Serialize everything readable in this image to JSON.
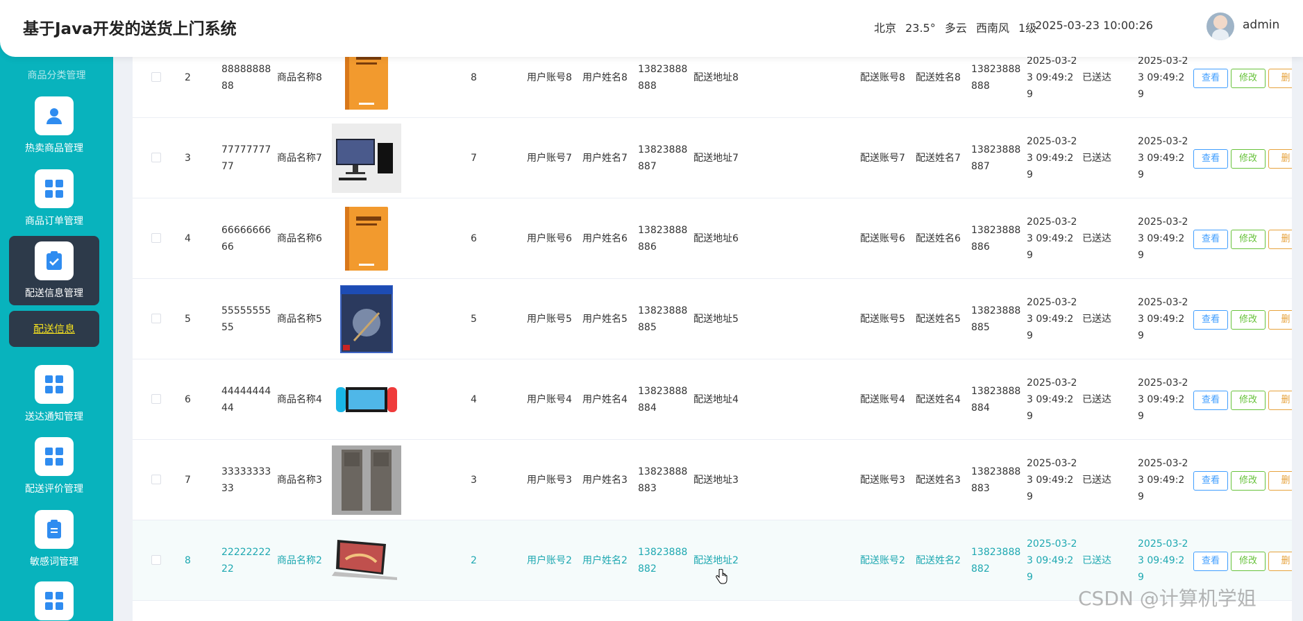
{
  "header": {
    "title": "基于Java开发的送货上门系统",
    "weather": {
      "city": "北京",
      "temp": "23.5°",
      "sky": "多云",
      "wind": "西南风",
      "level": "1级"
    },
    "datetime": "2025-03-23 10:00:26",
    "username": "admin"
  },
  "sidebar": {
    "cut_label": "商品分类管理",
    "items": [
      {
        "label": "热卖商品管理",
        "icon": "user-icon"
      },
      {
        "label": "商品订单管理",
        "icon": "grid-icon"
      },
      {
        "label": "配送信息管理",
        "icon": "clipboard-check-icon"
      },
      {
        "label": "送达通知管理",
        "icon": "grid-icon"
      },
      {
        "label": "配送评价管理",
        "icon": "grid-icon"
      },
      {
        "label": "敏感词管理",
        "icon": "clipboard-icon"
      }
    ],
    "active_sub": "配送信息"
  },
  "table": {
    "buttons": {
      "view": "查看",
      "edit": "修改",
      "delete": "删"
    },
    "rows": [
      {
        "index": "2",
        "order_no": "8888888888",
        "goods_name": "商品名称8",
        "image": "book",
        "qty": "8",
        "user_account": "用户账号8",
        "user_name": "用户姓名8",
        "phone": "13823888888",
        "address": "配送地址8",
        "courier_account": "配送账号8",
        "courier_name": "配送姓名8",
        "courier_phone": "13823888888",
        "time1": "2025-03-23 09:49:29",
        "status": "已送达",
        "time2": "2025-03-23 09:49:29"
      },
      {
        "index": "3",
        "order_no": "7777777777",
        "goods_name": "商品名称7",
        "image": "pc",
        "qty": "7",
        "user_account": "用户账号7",
        "user_name": "用户姓名7",
        "phone": "13823888887",
        "address": "配送地址7",
        "courier_account": "配送账号7",
        "courier_name": "配送姓名7",
        "courier_phone": "13823888887",
        "time1": "2025-03-23 09:49:29",
        "status": "已送达",
        "time2": "2025-03-23 09:49:29"
      },
      {
        "index": "4",
        "order_no": "6666666666",
        "goods_name": "商品名称6",
        "image": "book",
        "qty": "6",
        "user_account": "用户账号6",
        "user_name": "用户姓名6",
        "phone": "13823888886",
        "address": "配送地址6",
        "courier_account": "配送账号6",
        "courier_name": "配送姓名6",
        "courier_phone": "13823888886",
        "time1": "2025-03-23 09:49:29",
        "status": "已送达",
        "time2": "2025-03-23 09:49:29"
      },
      {
        "index": "5",
        "order_no": "5555555555",
        "goods_name": "商品名称5",
        "image": "game",
        "qty": "5",
        "user_account": "用户账号5",
        "user_name": "用户姓名5",
        "phone": "13823888885",
        "address": "配送地址5",
        "courier_account": "配送账号5",
        "courier_name": "配送姓名5",
        "courier_phone": "13823888885",
        "time1": "2025-03-23 09:49:29",
        "status": "已送达",
        "time2": "2025-03-23 09:49:29"
      },
      {
        "index": "6",
        "order_no": "4444444444",
        "goods_name": "商品名称4",
        "image": "switch",
        "qty": "4",
        "user_account": "用户账号4",
        "user_name": "用户姓名4",
        "phone": "13823888884",
        "address": "配送地址4",
        "courier_account": "配送账号4",
        "courier_name": "配送姓名4",
        "courier_phone": "13823888884",
        "time1": "2025-03-23 09:49:29",
        "status": "已送达",
        "time2": "2025-03-23 09:49:29"
      },
      {
        "index": "7",
        "order_no": "3333333333",
        "goods_name": "商品名称3",
        "image": "speakers",
        "qty": "3",
        "user_account": "用户账号3",
        "user_name": "用户姓名3",
        "phone": "13823888883",
        "address": "配送地址3",
        "courier_account": "配送账号3",
        "courier_name": "配送姓名3",
        "courier_phone": "13823888883",
        "time1": "2025-03-23 09:49:29",
        "status": "已送达",
        "time2": "2025-03-23 09:49:29"
      },
      {
        "index": "8",
        "order_no": "2222222222",
        "goods_name": "商品名称2",
        "image": "laptop",
        "qty": "2",
        "user_account": "用户账号2",
        "user_name": "用户姓名2",
        "phone": "13823888882",
        "address": "配送地址2",
        "courier_account": "配送账号2",
        "courier_name": "配送姓名2",
        "courier_phone": "13823888882",
        "time1": "2025-03-23 09:49:29",
        "status": "已送达",
        "time2": "2025-03-23 09:49:29"
      }
    ]
  },
  "watermark": "CSDN @计算机学姐",
  "colors": {
    "sidebar": "#08b3bd",
    "active": "#2d3a4a",
    "accent": "#1ea8b1"
  }
}
